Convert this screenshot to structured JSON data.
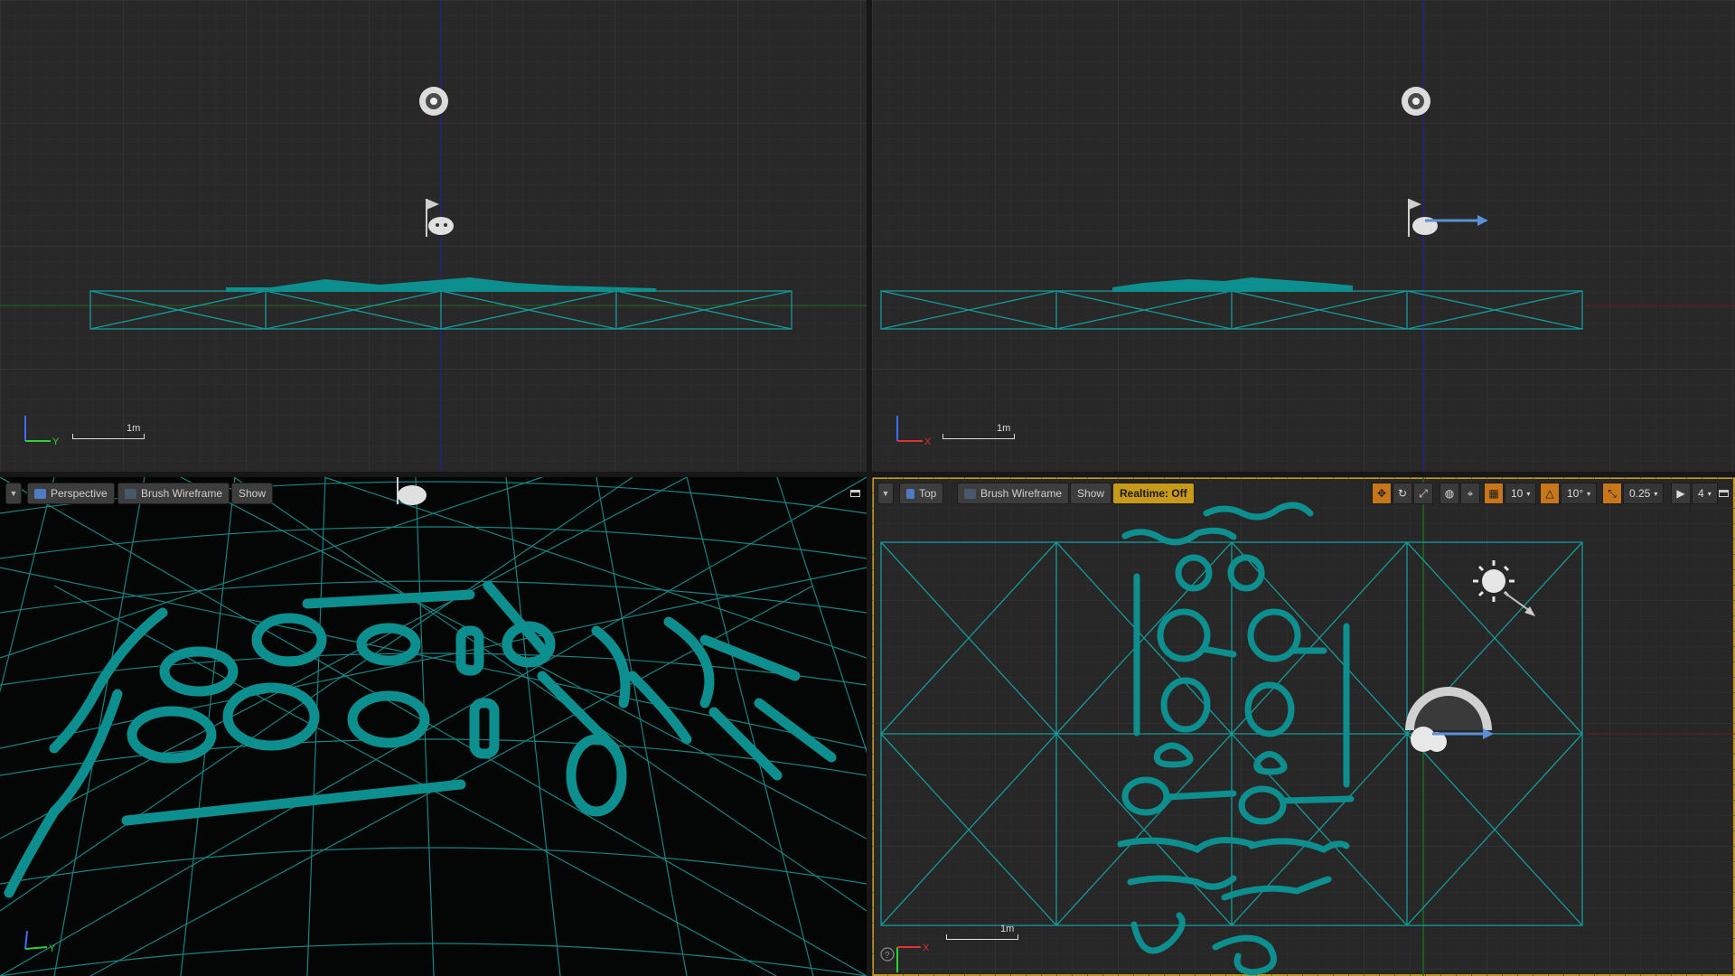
{
  "viewports": {
    "front": {
      "scale_label": "1m",
      "axis_h": "Y",
      "axis_v": "Z"
    },
    "side": {
      "scale_label": "1m",
      "axis_h": "X",
      "axis_v": "Z"
    },
    "perspective": {
      "menu_arrow": "▼",
      "view_mode": "Perspective",
      "render_mode": "Brush Wireframe",
      "show_label": "Show",
      "axis_h": "Y",
      "axis_v": "X"
    },
    "top": {
      "menu_arrow": "▼",
      "view_mode": "Top",
      "render_mode": "Brush Wireframe",
      "show_label": "Show",
      "realtime_label": "Realtime: Off",
      "grid_snap_value": "10",
      "rotation_snap_value": "10°",
      "scale_snap_value": "0.25",
      "camera_speed_value": "4",
      "scale_label": "1m",
      "axis_h": "X",
      "axis_v": "Y"
    }
  },
  "icons": [
    "translate-icon",
    "rotate-icon",
    "scale-icon",
    "world-space-icon",
    "surface-snap-icon",
    "grid-snap-icon",
    "rotation-snap-icon",
    "scale-snap-icon",
    "camera-speed-icon",
    "maximize-icon",
    "gamepad-icon",
    "flag-icon",
    "sun-icon",
    "sky-dome-icon",
    "reflection-capture-icon"
  ],
  "colors": {
    "brush": "#0e8f8f",
    "wire": "#1ea8a8",
    "realtime_bg": "#c79a19",
    "active_border": "#c49a20"
  }
}
